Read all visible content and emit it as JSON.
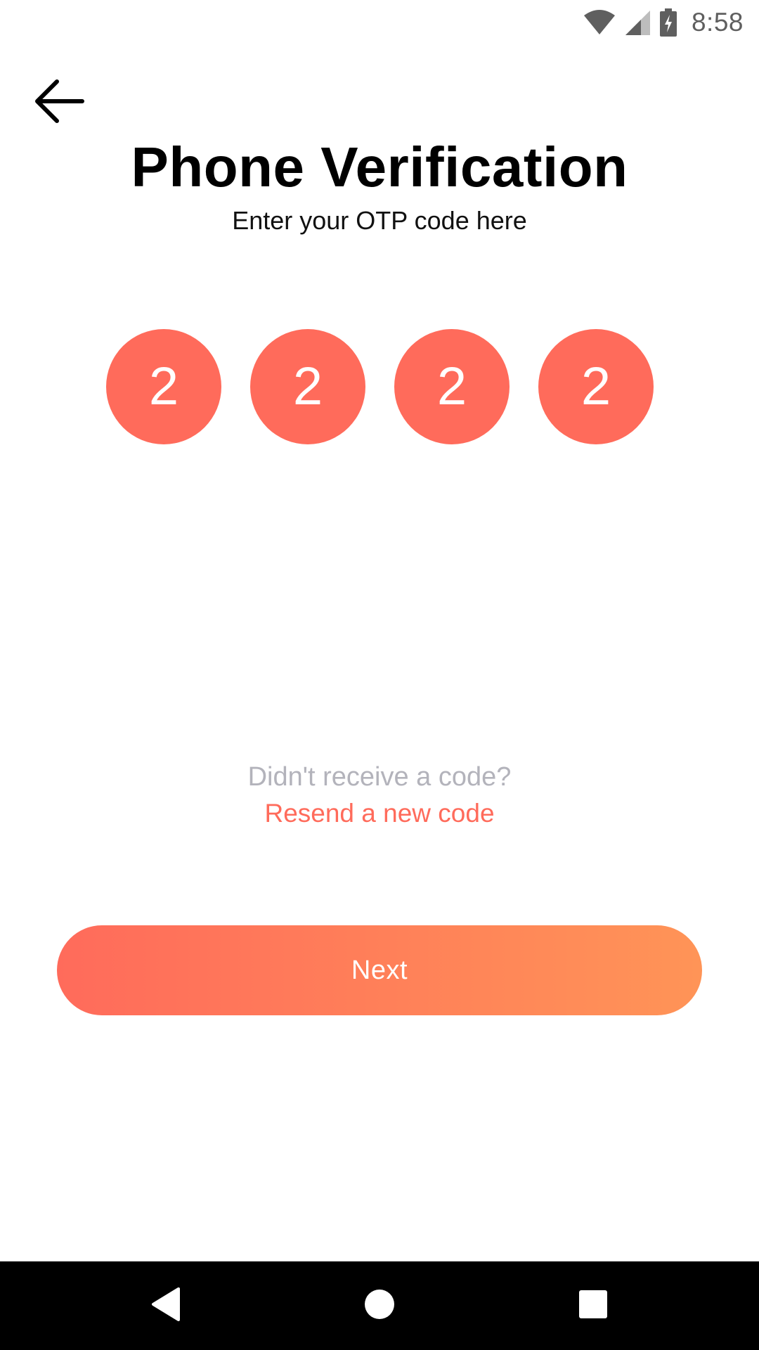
{
  "status_bar": {
    "time": "8:58",
    "icons": [
      "wifi-icon",
      "cellular-signal-icon",
      "battery-charging-icon"
    ]
  },
  "header": {
    "back_icon": "arrow-left-icon",
    "title": "Phone Verification",
    "subtitle": "Enter your OTP code here"
  },
  "otp": {
    "digits": [
      "2",
      "2",
      "2",
      "2"
    ]
  },
  "resend": {
    "prompt": "Didn't receive a code?",
    "link_label": "Resend a new code"
  },
  "next_button": {
    "label": "Next"
  },
  "nav_bar": {
    "icons": [
      "nav-back-icon",
      "nav-home-icon",
      "nav-recents-icon"
    ]
  },
  "colors": {
    "accent": "#ff6b5b",
    "accent_gradient_end": "#ff9457",
    "muted_text": "#b3b3bb"
  }
}
